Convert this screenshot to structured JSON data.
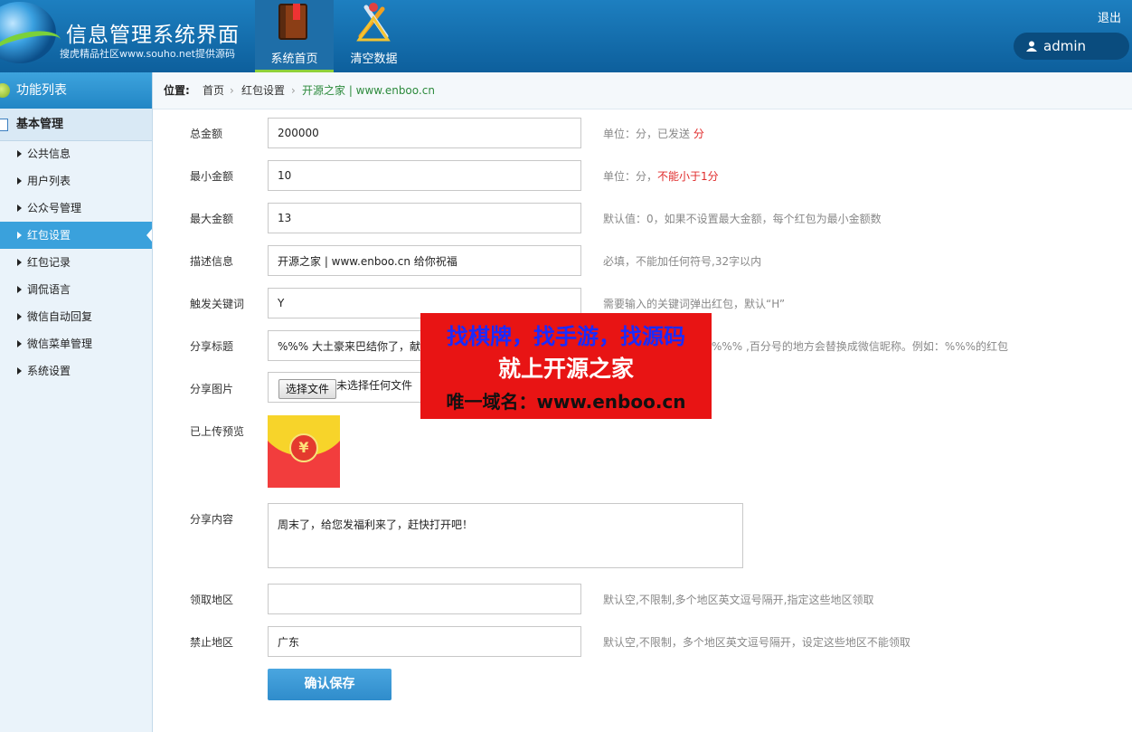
{
  "header": {
    "title": "信息管理系统界面",
    "subtitle": "搜虎精品社区www.souho.net提供源码",
    "nav": [
      {
        "label": "系统首页",
        "icon": "book-icon",
        "active": true
      },
      {
        "label": "清空数据",
        "icon": "tools-icon",
        "active": false
      }
    ],
    "logout": "退出",
    "user": "admin"
  },
  "sidebar": {
    "heading": "功能列表",
    "group": "基本管理",
    "items": [
      {
        "label": "公共信息"
      },
      {
        "label": "用户列表"
      },
      {
        "label": "公众号管理"
      },
      {
        "label": "红包设置",
        "active": true
      },
      {
        "label": "红包记录"
      },
      {
        "label": "调侃语言"
      },
      {
        "label": "微信自动回复"
      },
      {
        "label": "微信菜单管理"
      },
      {
        "label": "系统设置"
      }
    ]
  },
  "breadcrumb": {
    "label": "位置:",
    "items": [
      "首页",
      "红包设置",
      "开源之家 | www.enboo.cn"
    ]
  },
  "form": {
    "total_amount": {
      "label": "总金额",
      "value": "200000",
      "help": "单位：分，已发送",
      "help_red": "分"
    },
    "min_amount": {
      "label": "最小金额",
      "value": "10",
      "help": "单位：分，",
      "help_red": "不能小于1分"
    },
    "max_amount": {
      "label": "最大金额",
      "value": "13",
      "help": "默认值：0，如果不设置最大金额，每个红包为最小金额数"
    },
    "description": {
      "label": "描述信息",
      "value": "开源之家 | www.enboo.cn 给你祝福",
      "help": "必填，不能加任何符号,32字以内"
    },
    "keyword": {
      "label": "触发关键词",
      "value": "Y",
      "help": "需要输入的关键词弹出红包，默认“H”"
    },
    "share_title": {
      "label": "分享标题",
      "value": "%%% 大土豪来巴结你了，献上",
      "help": "%%% ,百分号的地方会替换成微信昵称。例如：%%%的红包"
    },
    "share_image": {
      "label": "分享图片",
      "button": "选择文件",
      "status": "未选择任何文件"
    },
    "preview": {
      "label": "已上传预览",
      "symbol": "¥"
    },
    "share_content": {
      "label": "分享内容",
      "value": "周末了，给您发福利来了，赶快打开吧！"
    },
    "allow_region": {
      "label": "领取地区",
      "value": "",
      "help": "默认空,不限制,多个地区英文逗号隔开,指定这些地区领取"
    },
    "block_region": {
      "label": "禁止地区",
      "value": "广东",
      "help": "默认空,不限制，多个地区英文逗号隔开，设定这些地区不能领取"
    },
    "save": "确认保存"
  },
  "overlay_ad": {
    "line1": "找棋牌，找手游，找源码",
    "line2": "就上开源之家",
    "line3": "唯一域名：www.enboo.cn"
  }
}
